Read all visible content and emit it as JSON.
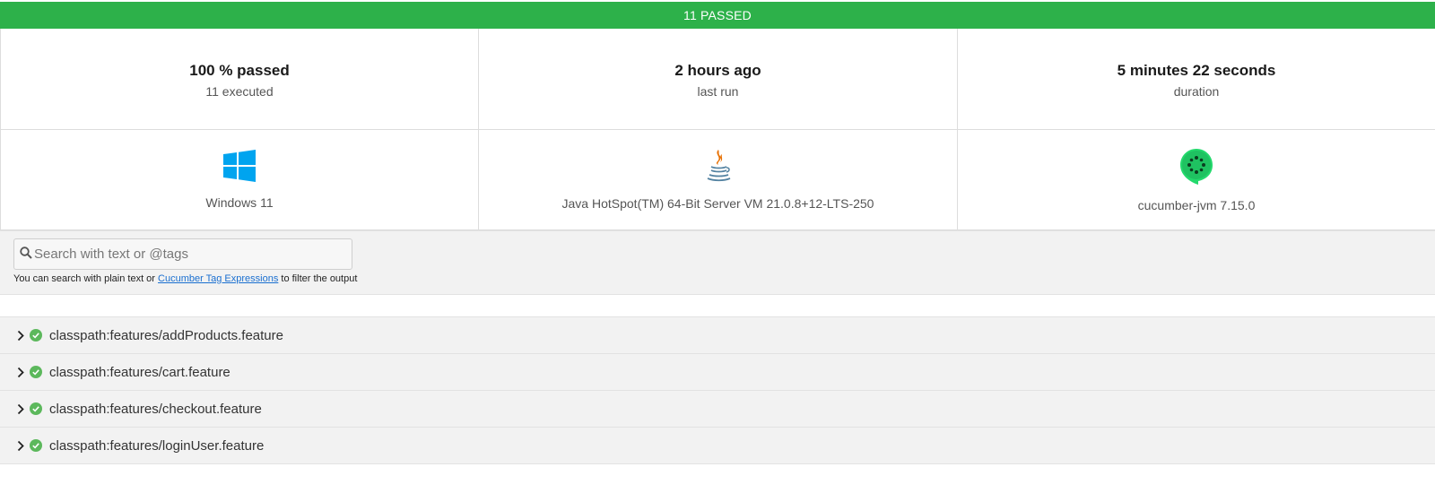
{
  "banner": {
    "text": "11 PASSED",
    "color": "#2db14a"
  },
  "stats": [
    {
      "main": "100 % passed",
      "sub": "11 executed"
    },
    {
      "main": "2 hours ago",
      "sub": "last run"
    },
    {
      "main": "5 minutes 22 seconds",
      "sub": "duration"
    }
  ],
  "environment": [
    {
      "icon": "windows-logo-icon",
      "label": "Windows 11"
    },
    {
      "icon": "java-logo-icon",
      "label": "Java HotSpot(TM) 64-Bit Server VM 21.0.8+12-LTS-250"
    },
    {
      "icon": "cucumber-logo-icon",
      "label": "cucumber-jvm 7.15.0"
    }
  ],
  "search": {
    "placeholder": "Search with text or @tags",
    "value": "",
    "hint_before": "You can search with plain text or ",
    "hint_link": "Cucumber Tag Expressions",
    "hint_after": " to filter the output"
  },
  "features": [
    {
      "name": "classpath:features/addProducts.feature",
      "status": "passed"
    },
    {
      "name": "classpath:features/cart.feature",
      "status": "passed"
    },
    {
      "name": "classpath:features/checkout.feature",
      "status": "passed"
    },
    {
      "name": "classpath:features/loginUser.feature",
      "status": "passed"
    }
  ],
  "colors": {
    "passed": "#2db14a",
    "status_icon": "#5cb85c",
    "windows": "#00a4ef",
    "java_flame": "#e76f00",
    "java_cup": "#5382a1",
    "cucumber": "#23d96c",
    "link": "#1a6fd0"
  }
}
